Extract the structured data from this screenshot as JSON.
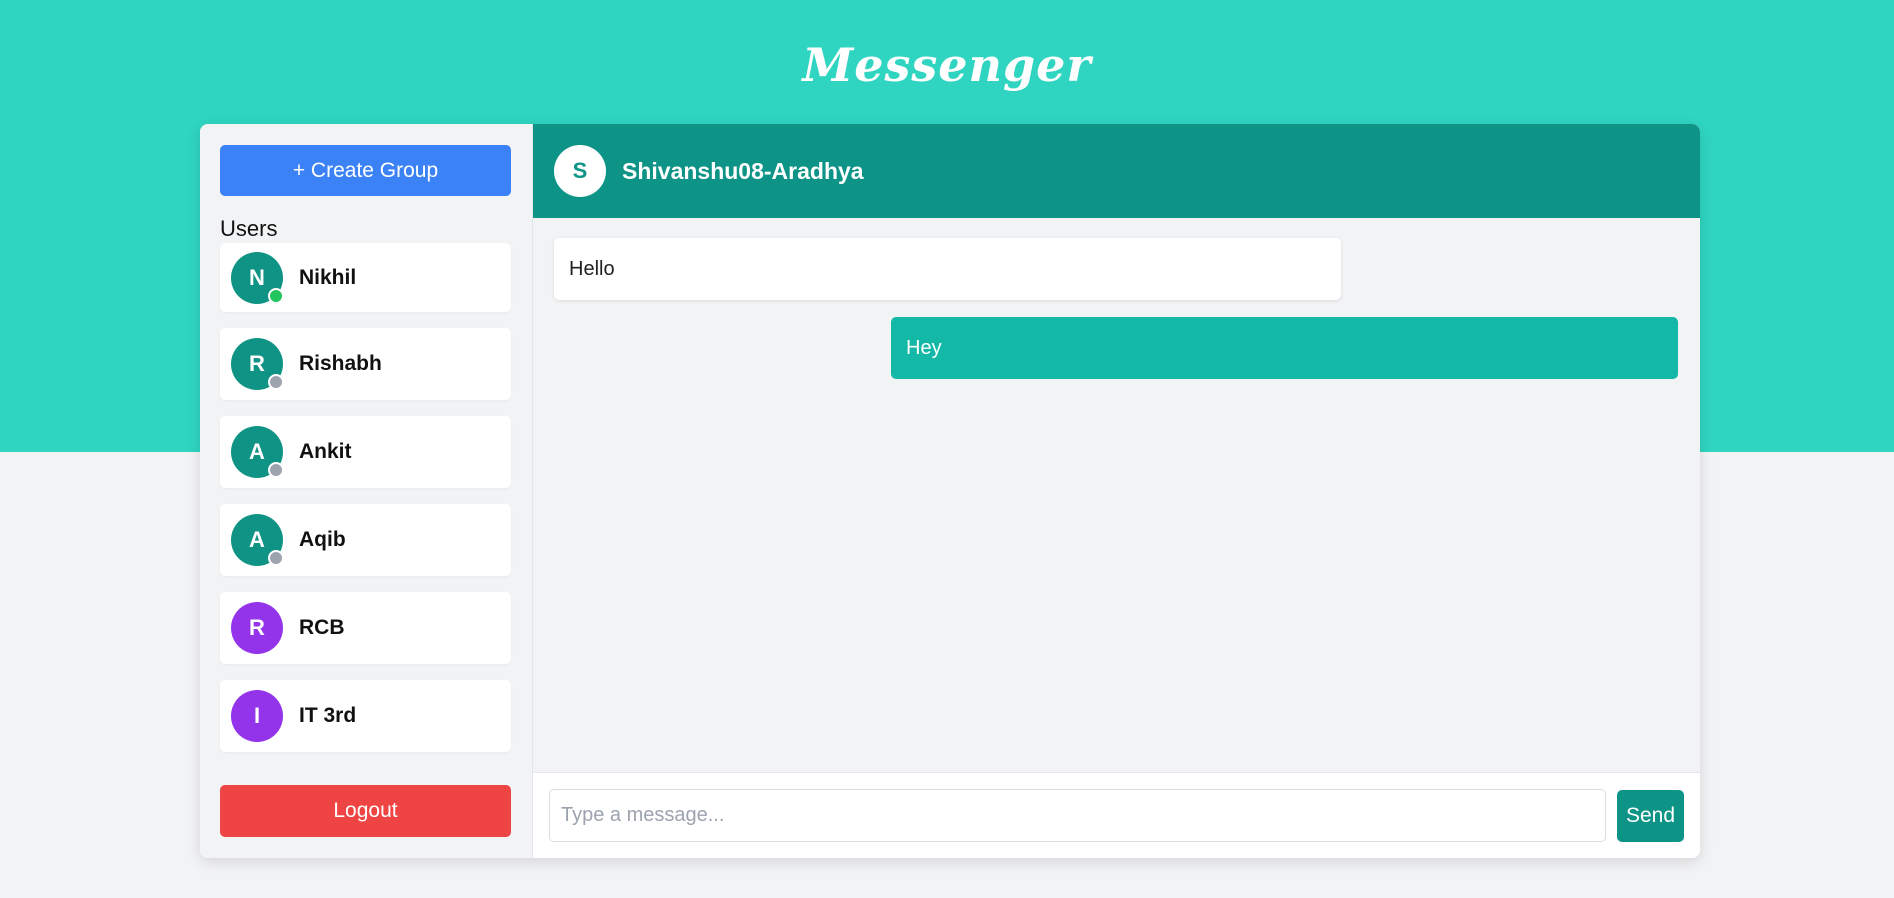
{
  "app": {
    "title": "Messenger"
  },
  "colors": {
    "brand_band": "#2fd5c1",
    "header": "#0e9486",
    "create_button": "#3b82f6",
    "logout_button": "#ef4444",
    "outgoing_bubble": "#14b8a6",
    "avatar_user": "#0f9384",
    "avatar_group": "#9333ea",
    "online": "#22c55e",
    "offline": "#9ca3af"
  },
  "sidebar": {
    "create_group_label": "+ Create Group",
    "users_title": "Users",
    "users": [
      {
        "initial": "N",
        "name": "Nikhil",
        "status": "online",
        "type": "user"
      },
      {
        "initial": "R",
        "name": "Rishabh",
        "status": "offline",
        "type": "user"
      },
      {
        "initial": "A",
        "name": "Ankit",
        "status": "offline",
        "type": "user"
      },
      {
        "initial": "A",
        "name": "Aqib",
        "status": "offline",
        "type": "user"
      },
      {
        "initial": "R",
        "name": "RCB",
        "status": "",
        "type": "group"
      },
      {
        "initial": "I",
        "name": "IT 3rd",
        "status": "",
        "type": "group"
      }
    ],
    "logout_label": "Logout"
  },
  "chat": {
    "header": {
      "initial": "S",
      "name": "Shivanshu08-Aradhya"
    },
    "messages": [
      {
        "text": "Hello",
        "direction": "incoming"
      },
      {
        "text": "Hey",
        "direction": "outgoing"
      }
    ],
    "composer": {
      "placeholder": "Type a message...",
      "value": "",
      "send_label": "Send"
    }
  }
}
